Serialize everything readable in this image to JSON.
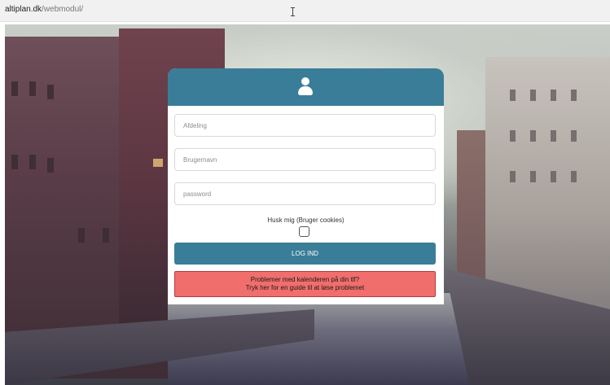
{
  "browser": {
    "url_host": "altiplan.dk",
    "url_path": "/webmodul/"
  },
  "login": {
    "user_icon": "user-icon",
    "department_placeholder": "Afdeling",
    "username_placeholder": "Brugernavn",
    "password_placeholder": "password",
    "remember_label": "Husk mig (Bruger cookies)",
    "remember_checked": false,
    "login_label": "LOG IND",
    "problem_line1": "Problemer med kalenderen på din tlf?",
    "problem_line2": "Tryk her for en guide til at løse problemet"
  },
  "colors": {
    "accent": "#3a7d98",
    "alert": "#f06e6c"
  }
}
